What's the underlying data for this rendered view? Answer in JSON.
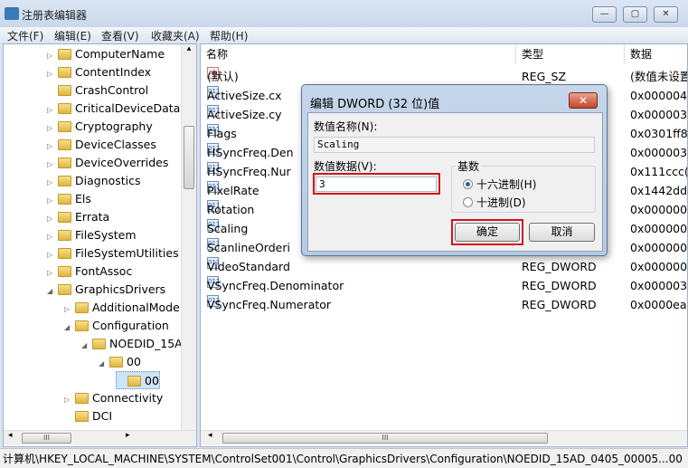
{
  "window": {
    "title": "注册表编辑器",
    "minimize": "—",
    "maximize": "▢",
    "close": "✕"
  },
  "menu": [
    "文件(F)",
    "编辑(E)",
    "查看(V)",
    "收藏夹(A)",
    "帮助(H)"
  ],
  "tree": [
    {
      "label": "ComputerName",
      "level": 0,
      "expander": "▷"
    },
    {
      "label": "ContentIndex",
      "level": 0,
      "expander": "▷"
    },
    {
      "label": "CrashControl",
      "level": 0,
      "expander": ""
    },
    {
      "label": "CriticalDeviceDatab",
      "level": 0,
      "expander": "▷"
    },
    {
      "label": "Cryptography",
      "level": 0,
      "expander": "▷"
    },
    {
      "label": "DeviceClasses",
      "level": 0,
      "expander": "▷"
    },
    {
      "label": "DeviceOverrides",
      "level": 0,
      "expander": "▷"
    },
    {
      "label": "Diagnostics",
      "level": 0,
      "expander": "▷"
    },
    {
      "label": "Els",
      "level": 0,
      "expander": "▷"
    },
    {
      "label": "Errata",
      "level": 0,
      "expander": "▷"
    },
    {
      "label": "FileSystem",
      "level": 0,
      "expander": "▷"
    },
    {
      "label": "FileSystemUtilities",
      "level": 0,
      "expander": "▷"
    },
    {
      "label": "FontAssoc",
      "level": 0,
      "expander": "▷"
    },
    {
      "label": "GraphicsDrivers",
      "level": 0,
      "expander": "◢"
    },
    {
      "label": "AdditionalMode",
      "level": 1,
      "expander": "▷"
    },
    {
      "label": "Configuration",
      "level": 1,
      "expander": "◢"
    },
    {
      "label": "NOEDID_15A",
      "level": 2,
      "expander": "◢"
    },
    {
      "label": "00",
      "level": 3,
      "expander": "◢"
    },
    {
      "label": "00",
      "level": 4,
      "expander": "",
      "selected": true
    },
    {
      "label": "Connectivity",
      "level": 1,
      "expander": "▷"
    },
    {
      "label": "DCI",
      "level": 1,
      "expander": ""
    }
  ],
  "columns": {
    "name": "名称",
    "type": "类型",
    "data": "数据"
  },
  "values": [
    {
      "name": "(默认)",
      "type": "REG_SZ",
      "data": "(数值未设置)",
      "icon": "string"
    },
    {
      "name": "ActiveSize.cx",
      "type": "",
      "data": "0x000004",
      "icon": "binary"
    },
    {
      "name": "ActiveSize.cy",
      "type": "",
      "data": "0x000003",
      "icon": "binary"
    },
    {
      "name": "Flags",
      "type": "",
      "data": "0x0301ff8",
      "icon": "binary"
    },
    {
      "name": "HSyncFreq.Den",
      "type": "",
      "data": "0x000003",
      "icon": "binary"
    },
    {
      "name": "HSyncFreq.Nur",
      "type": "",
      "data": "0x111ccc(",
      "icon": "binary"
    },
    {
      "name": "PixelRate",
      "type": "",
      "data": "0x1442dd",
      "icon": "binary"
    },
    {
      "name": "Rotation",
      "type": "",
      "data": "0x000000",
      "icon": "binary"
    },
    {
      "name": "Scaling",
      "type": "",
      "data": "0x000000",
      "icon": "binary"
    },
    {
      "name": "ScanlineOrderi",
      "type": "",
      "data": "0x000000",
      "icon": "binary"
    },
    {
      "name": "VideoStandard",
      "type": "REG_DWORD",
      "data": "0x000000",
      "icon": "binary"
    },
    {
      "name": "VSyncFreq.Denominator",
      "type": "REG_DWORD",
      "data": "0x000003",
      "icon": "binary"
    },
    {
      "name": "VSyncFreq.Numerator",
      "type": "REG_DWORD",
      "data": "0x0000ea",
      "icon": "binary"
    }
  ],
  "dialog": {
    "title": "编辑 DWORD (32 位)值",
    "close": "✕",
    "name_label": "数值名称(N):",
    "name_value": "Scaling",
    "data_label": "数值数据(V):",
    "data_value": "3",
    "base_label": "基数",
    "hex_label": "十六进制(H)",
    "dec_label": "十进制(D)",
    "selected_base": "hex",
    "ok": "确定",
    "cancel": "取消",
    "highlight_color": "#d0151e"
  },
  "status": "计算机\\HKEY_LOCAL_MACHINE\\SYSTEM\\ControlSet001\\Control\\GraphicsDrivers\\Configuration\\NOEDID_15AD_0405_00005...00",
  "scroll": {
    "grip": "III",
    "left": "◂",
    "right": "▸",
    "up": "▴"
  }
}
